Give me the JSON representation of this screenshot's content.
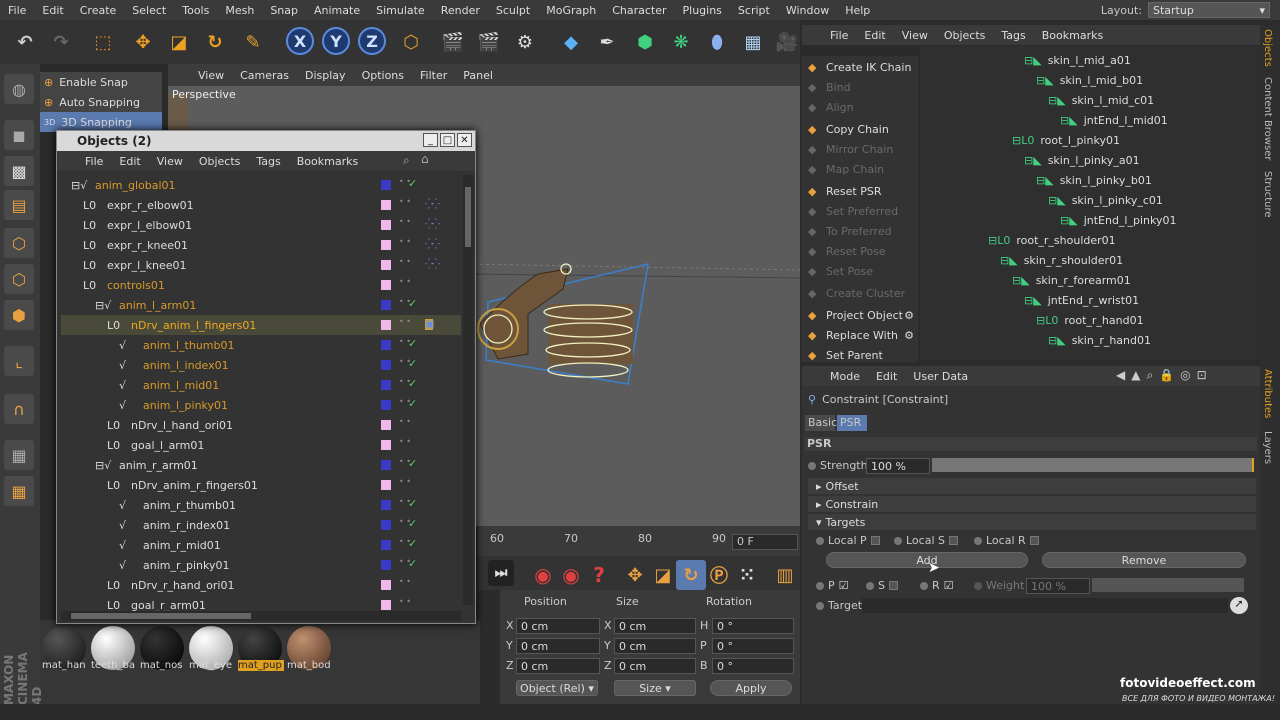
{
  "menubar": {
    "items": [
      "File",
      "Edit",
      "Create",
      "Select",
      "Tools",
      "Mesh",
      "Snap",
      "Animate",
      "Simulate",
      "Render",
      "Sculpt",
      "MoGraph",
      "Character",
      "Plugins",
      "Script",
      "Window",
      "Help"
    ],
    "layout_label": "Layout:",
    "layout_value": "Startup"
  },
  "toolbar": {
    "x": "X",
    "y": "Y",
    "z": "Z"
  },
  "snap_menu": {
    "items": [
      "Enable Snap",
      "Auto Snapping",
      "3D Snapping"
    ]
  },
  "viewport": {
    "menu": [
      "View",
      "Cameras",
      "Display",
      "Options",
      "Filter",
      "Panel"
    ],
    "label": "Perspective"
  },
  "timeline": {
    "ticks": [
      "60",
      "70",
      "80",
      "90"
    ],
    "frame": "0 F"
  },
  "coords": {
    "headers": [
      "Position",
      "Size",
      "Rotation"
    ],
    "rows": [
      {
        "axis": "X",
        "pos": "0 cm",
        "saxis": "X",
        "size": "0 cm",
        "raxis": "H",
        "rot": "0 °"
      },
      {
        "axis": "Y",
        "pos": "0 cm",
        "saxis": "Y",
        "size": "0 cm",
        "raxis": "P",
        "rot": "0 °"
      },
      {
        "axis": "Z",
        "pos": "0 cm",
        "saxis": "Z",
        "size": "0 cm",
        "raxis": "B",
        "rot": "0 °"
      }
    ],
    "mode": "Object (Rel)",
    "size_mode": "Size",
    "apply": "Apply"
  },
  "materials": [
    "mat_han",
    "teeth_ba",
    "mat_nos",
    "mat_eye",
    "mat_pup",
    "mat_bod"
  ],
  "brand": "MAXON CINEMA 4D",
  "objects_window": {
    "title": "Objects (2)",
    "menu": [
      "File",
      "Edit",
      "View",
      "Objects",
      "Tags",
      "Bookmarks"
    ],
    "rows": [
      {
        "name": "anim_global01",
        "indent": 0,
        "color": "#d89a2a",
        "layer": "#3a3ac8",
        "check": "✓"
      },
      {
        "name": "expr_r_elbow01",
        "indent": 1,
        "color": "#ddd",
        "layer": "#f0b8e8",
        "check": "",
        "tag": "⁛⁛"
      },
      {
        "name": "expr_l_elbow01",
        "indent": 1,
        "color": "#ddd",
        "layer": "#f0b8e8",
        "check": "",
        "tag": "⁛⁛"
      },
      {
        "name": "expr_r_knee01",
        "indent": 1,
        "color": "#ddd",
        "layer": "#f0b8e8",
        "check": "",
        "tag": "⁛⁛"
      },
      {
        "name": "expr_l_knee01",
        "indent": 1,
        "color": "#ddd",
        "layer": "#f0b8e8",
        "check": "",
        "tag": "⁛⁛"
      },
      {
        "name": "controls01",
        "indent": 1,
        "color": "#d89a2a",
        "layer": "#f0b8e8",
        "check": ""
      },
      {
        "name": "anim_l_arm01",
        "indent": 2,
        "color": "#d89a2a",
        "layer": "#3a3ac8",
        "check": "✓"
      },
      {
        "name": "nDrv_anim_l_fingers01",
        "indent": 3,
        "color": "#f0a820",
        "layer": "#f0b8e8",
        "check": "",
        "tag": "▣"
      },
      {
        "name": "anim_l_thumb01",
        "indent": 4,
        "color": "#d89a2a",
        "layer": "#3a3ac8",
        "check": "✓"
      },
      {
        "name": "anim_l_index01",
        "indent": 4,
        "color": "#d89a2a",
        "layer": "#3a3ac8",
        "check": "✓"
      },
      {
        "name": "anim_l_mid01",
        "indent": 4,
        "color": "#d89a2a",
        "layer": "#3a3ac8",
        "check": "✓"
      },
      {
        "name": "anim_l_pinky01",
        "indent": 4,
        "color": "#d89a2a",
        "layer": "#3a3ac8",
        "check": "✓"
      },
      {
        "name": "nDrv_l_hand_ori01",
        "indent": 3,
        "color": "#ddd",
        "layer": "#f0b8e8",
        "check": ""
      },
      {
        "name": "goal_l_arm01",
        "indent": 3,
        "color": "#ddd",
        "layer": "#f0b8e8",
        "check": ""
      },
      {
        "name": "anim_r_arm01",
        "indent": 2,
        "color": "#ddd",
        "layer": "#3a3ac8",
        "check": "✓"
      },
      {
        "name": "nDrv_anim_r_fingers01",
        "indent": 3,
        "color": "#ddd",
        "layer": "#f0b8e8",
        "check": ""
      },
      {
        "name": "anim_r_thumb01",
        "indent": 4,
        "color": "#ddd",
        "layer": "#3a3ac8",
        "check": "✓"
      },
      {
        "name": "anim_r_index01",
        "indent": 4,
        "color": "#ddd",
        "layer": "#3a3ac8",
        "check": "✓"
      },
      {
        "name": "anim_r_mid01",
        "indent": 4,
        "color": "#ddd",
        "layer": "#3a3ac8",
        "check": "✓"
      },
      {
        "name": "anim_r_pinky01",
        "indent": 4,
        "color": "#ddd",
        "layer": "#3a3ac8",
        "check": "✓"
      },
      {
        "name": "nDrv_r_hand_ori01",
        "indent": 3,
        "color": "#ddd",
        "layer": "#f0b8e8",
        "check": ""
      },
      {
        "name": "goal_r_arm01",
        "indent": 3,
        "color": "#ddd",
        "layer": "#f0b8e8",
        "check": ""
      }
    ]
  },
  "commands": [
    {
      "label": "Create IK Chain",
      "enabled": true
    },
    {
      "label": "Bind",
      "enabled": false
    },
    {
      "label": "Align",
      "enabled": false
    },
    {
      "label": "Copy Chain",
      "enabled": true
    },
    {
      "label": "Mirror Chain",
      "enabled": false
    },
    {
      "label": "Map Chain",
      "enabled": false
    },
    {
      "label": "Reset PSR",
      "enabled": true
    },
    {
      "label": "Set Preferred",
      "enabled": false
    },
    {
      "label": "To Preferred",
      "enabled": false
    },
    {
      "label": "Reset Pose",
      "enabled": false
    },
    {
      "label": "Set Pose",
      "enabled": false
    },
    {
      "label": "Create Cluster",
      "enabled": false
    },
    {
      "label": "Project Object",
      "enabled": true
    },
    {
      "label": "Replace With",
      "enabled": true
    },
    {
      "label": "Set Parent",
      "enabled": true
    }
  ],
  "tree": {
    "menu": [
      "File",
      "Edit",
      "View",
      "Objects",
      "Tags",
      "Bookmarks"
    ],
    "rows": [
      {
        "name": "skin_l_mid_a01",
        "level": 3
      },
      {
        "name": "skin_l_mid_b01",
        "level": 4
      },
      {
        "name": "skin_l_mid_c01",
        "level": 5
      },
      {
        "name": "jntEnd_l_mid01",
        "level": 6
      },
      {
        "name": "root_l_pinky01",
        "level": 2
      },
      {
        "name": "skin_l_pinky_a01",
        "level": 3
      },
      {
        "name": "skin_l_pinky_b01",
        "level": 4
      },
      {
        "name": "skin_l_pinky_c01",
        "level": 5
      },
      {
        "name": "jntEnd_l_pinky01",
        "level": 6
      },
      {
        "name": "root_r_shoulder01",
        "level": 0
      },
      {
        "name": "skin_r_shoulder01",
        "level": 1
      },
      {
        "name": "skin_r_forearm01",
        "level": 2
      },
      {
        "name": "jntEnd_r_wrist01",
        "level": 3
      },
      {
        "name": "root_r_hand01",
        "level": 4
      },
      {
        "name": "skin_r_hand01",
        "level": 5
      }
    ]
  },
  "attributes": {
    "menu": [
      "Mode",
      "Edit",
      "User Data"
    ],
    "title": "Constraint [Constraint]",
    "tabs": [
      "Basic",
      "PSR"
    ],
    "section": "PSR",
    "strength_label": "Strength",
    "strength_value": "100 %",
    "strength_fill": 1.0,
    "groups": [
      "Offset",
      "Constrain",
      "Targets"
    ],
    "local": [
      "Local P",
      "Local S",
      "Local R"
    ],
    "add": "Add",
    "remove": "Remove",
    "psr": [
      "P",
      "S",
      "R"
    ],
    "weight_label": "Weight",
    "weight_value": "100 %",
    "target_label": "Target"
  },
  "vtabs": [
    "Objects",
    "Content Browser",
    "Structure",
    "Attributes",
    "Layers"
  ],
  "watermark": {
    "main": "fotovideoeffect.com",
    "sub": "ВСЕ ДЛЯ ФОТО И ВИДЕО МОНТАЖА!"
  }
}
